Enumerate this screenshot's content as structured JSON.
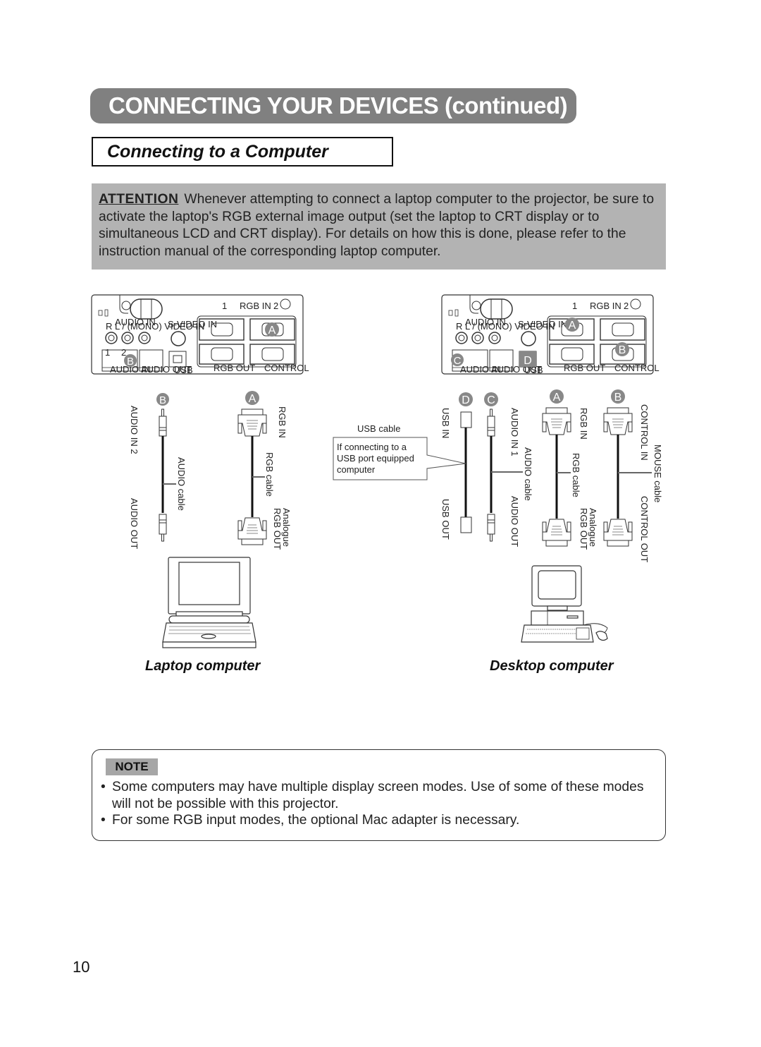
{
  "header": {
    "title": "CONNECTING YOUR DEVICES (continued)",
    "subtitle": "Connecting to a Computer"
  },
  "attention": {
    "label": "ATTENTION",
    "text": "Whenever attempting to connect a laptop computer to the projector, be sure to activate the laptop's RGB external image output (set the laptop to CRT display or to simultaneous LCD and CRT display). For details on how this is done, please refer to the instruction manual of the corresponding laptop computer."
  },
  "panel": {
    "rgb_in": "RGB   IN",
    "port1": "1",
    "port2": "2",
    "audio_in_header": "AUDIO IN",
    "audio_channels": "R      L / (MONO)  VIDEO IN",
    "svideo_in": "S-VIDEO IN",
    "audio_in": "AUDIO IN",
    "audio_out": "AUDIO OUT",
    "usb": "USB",
    "rgb_out": "RGB   OUT",
    "control": "CONTROL",
    "n1": "1",
    "n2": "2"
  },
  "markers": {
    "a": "A",
    "b": "B",
    "c": "C",
    "d": "D"
  },
  "laptop": {
    "caption": "Laptop computer",
    "audio_in2": "AUDIO IN 2",
    "audio_out": "AUDIO OUT",
    "audio_cable": "AUDIO cable",
    "rgb_in": "RGB IN",
    "rgb_cable": "RGB cable",
    "analogue": "Analogue",
    "rgb_out": "RGB OUT"
  },
  "desktop": {
    "caption": "Desktop computer",
    "usb_cable": "USB cable",
    "usb_note": [
      "If connecting to a",
      "USB port equipped",
      "computer"
    ],
    "usb_in": "USB IN",
    "usb_out": "USB OUT",
    "audio_in1": "AUDIO IN 1",
    "audio_out": "AUDIO OUT",
    "audio_cable": "AUDIO cable",
    "rgb_in": "RGB IN",
    "rgb_cable": "RGB cable",
    "analogue": "Analogue",
    "rgb_out": "RGB OUT",
    "control_in": "CONTROL IN",
    "mouse_cable": "MOUSE cable",
    "control_out": "CONTROL OUT"
  },
  "note": {
    "label": "NOTE",
    "items": [
      "Some computers may have multiple display screen modes. Use of some of these modes will not be possible with this projector.",
      "For some RGB input modes, the optional Mac adapter is necessary."
    ],
    "bullet": "•"
  },
  "page_number": "10"
}
